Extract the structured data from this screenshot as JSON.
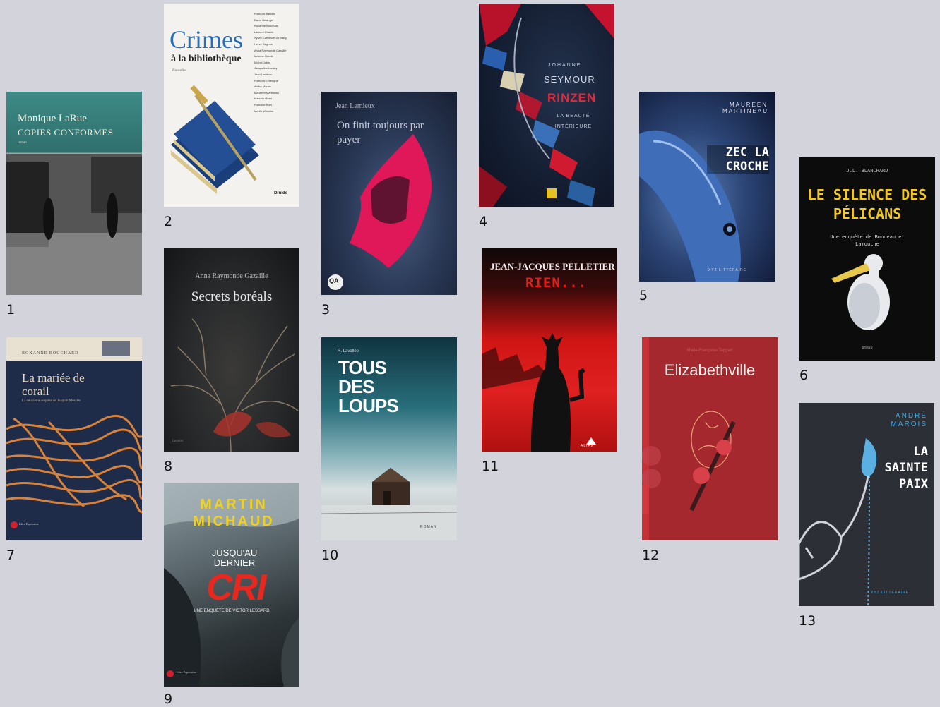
{
  "books": [
    {
      "number": "1",
      "author": "Monique LaRue",
      "title": "COPIES CONFORMES",
      "genre": "roman"
    },
    {
      "number": "2",
      "title_main": "Crimes",
      "title_sub": "à la bibliothèque",
      "genre": "Nouvelles",
      "publisher": "Druide",
      "authors": [
        "François Barcelo",
        "David Bélanger",
        "Roxanne Bouchard",
        "Laurent Chabin",
        "Sylvie-Catherine De Vailly",
        "Hervé Gagnon",
        "Anna Raymonde Gazaille",
        "Maxime Houde",
        "Michel Jobin",
        "Jacqueline Landry",
        "Jean Lemieux",
        "François Lévesque",
        "André Marois",
        "Maureen Martineau",
        "Marcelo Rosa",
        "Francine Ruel",
        "Martin Winckler"
      ]
    },
    {
      "number": "3",
      "author": "Jean Lemieux",
      "title": "On finit toujours par payer",
      "publisher": "QA"
    },
    {
      "number": "4",
      "author_first": "JOHANNE",
      "author_last": "SEYMOUR",
      "title": "RINZEN",
      "subtitle": "LA BEAUTÉ INTÉRIEURE"
    },
    {
      "number": "5",
      "author": "MAUREEN MARTINEAU",
      "title": "ZEC LA CROCHE",
      "publisher": "XYZ LITTÉRAIRE"
    },
    {
      "number": "6",
      "author": "J.L. BLANCHARD",
      "title": "LE SILENCE DES PÉLICANS",
      "subtitle": "Une enquête de Bonneau et Lamouche",
      "genre": "ROMAN"
    },
    {
      "number": "7",
      "author": "ROXANNE BOUCHARD",
      "title": "La mariée de corail",
      "subtitle": "La deuxième enquête de Joaquin Moralès",
      "publisher": "Libre Expression"
    },
    {
      "number": "8",
      "author": "Anna Raymonde Gazaille",
      "title": "Secrets boréals",
      "publisher": "Leméac"
    },
    {
      "number": "9",
      "author": "MARTIN MICHAUD",
      "title_top": "JUSQU'AU DERNIER",
      "title_big": "CRI",
      "subtitle": "UNE ENQUÊTE DE VICTOR LESSARD",
      "publisher": "Libre Expression"
    },
    {
      "number": "10",
      "author": "R. Lavallée",
      "title": "TOUS DES LOUPS",
      "genre": "ROMAN"
    },
    {
      "number": "11",
      "author": "JEAN-JACQUES PELLETIER",
      "title": "RIEN...",
      "publisher": "ALIRE"
    },
    {
      "number": "12",
      "author": "Marie-Françoise Taggart",
      "title": "Elizabethville"
    },
    {
      "number": "13",
      "author": "ANDRÉ MAROIS",
      "title": "LA SAINTE PAIX",
      "publisher": "XYZ LITTÉRAIRE"
    }
  ],
  "colors": {
    "background": "#d3d3dc",
    "label": "#111111"
  },
  "icons": {
    "book-cover-image": "book-cover-icon"
  }
}
